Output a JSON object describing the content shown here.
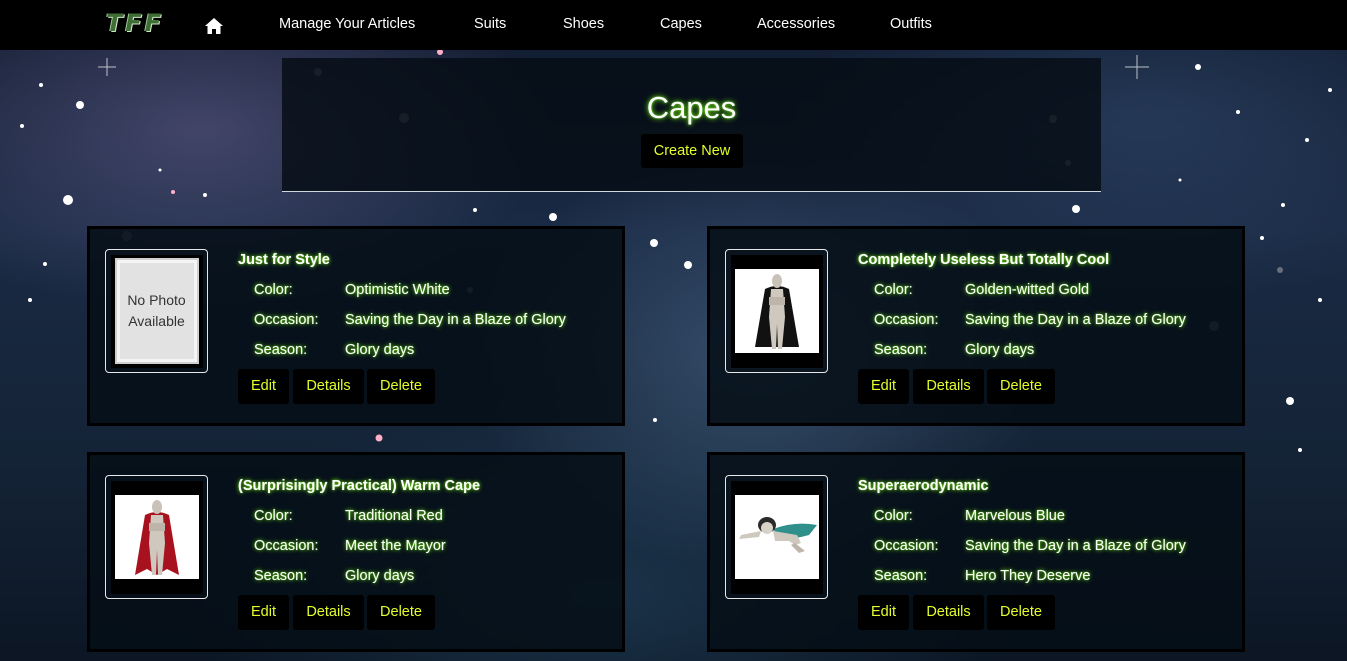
{
  "brand": "TFF",
  "nav": {
    "home_icon": "home-icon",
    "links": [
      "Manage Your Articles",
      "Suits",
      "Shoes",
      "Capes",
      "Accessories",
      "Outfits"
    ]
  },
  "header": {
    "title": "Capes",
    "create_label": "Create New"
  },
  "labels": {
    "color": "Color:",
    "occasion": "Occasion:",
    "season": "Season:",
    "edit": "Edit",
    "details": "Details",
    "delete": "Delete",
    "no_photo": "No Photo Available"
  },
  "cards": [
    {
      "title": "Just for Style",
      "color": "Optimistic White",
      "occasion": "Saving the Day in a Blaze of Glory",
      "season": "Glory days",
      "image": "no-photo"
    },
    {
      "title": "Completely Useless But Totally Cool",
      "color": "Golden-witted Gold",
      "occasion": "Saving the Day in a Blaze of Glory",
      "season": "Glory days",
      "image": "black-cape"
    },
    {
      "title": "(Surprisingly Practical) Warm Cape",
      "color": "Traditional Red",
      "occasion": "Meet the Mayor",
      "season": "Glory days",
      "image": "red-cape"
    },
    {
      "title": "Superaerodynamic",
      "color": "Marvelous Blue",
      "occasion": "Saving the Day in a Blaze of Glory",
      "season": "Hero They Deserve",
      "image": "flying-hero"
    }
  ],
  "colors": {
    "nav_bg": "#000000",
    "accent_text": "#e4ff2a",
    "glow": "#7fff00"
  }
}
